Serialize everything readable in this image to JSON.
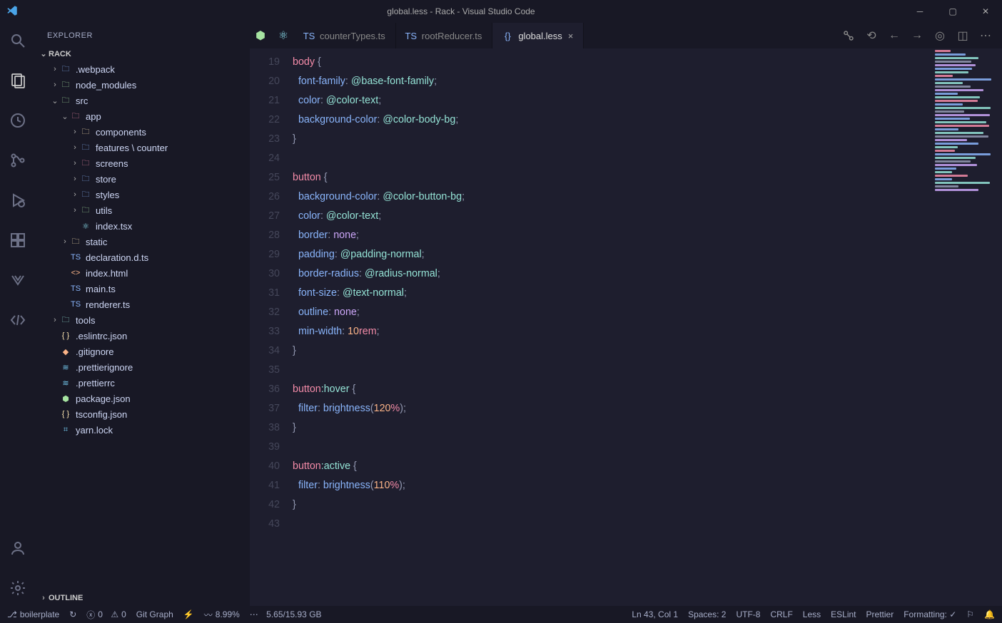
{
  "window": {
    "title": "global.less - Rack - Visual Studio Code"
  },
  "sidebar": {
    "title": "EXPLORER",
    "root": "RACK",
    "outline": "OUTLINE",
    "tree": [
      {
        "depth": 1,
        "chev": "›",
        "icon": "folder",
        "iconClass": "ic-folder",
        "label": ".webpack"
      },
      {
        "depth": 1,
        "chev": "›",
        "icon": "folder",
        "iconClass": "ic-folder-g",
        "label": "node_modules"
      },
      {
        "depth": 1,
        "chev": "⌄",
        "icon": "folder",
        "iconClass": "ic-folder-g",
        "label": "src"
      },
      {
        "depth": 2,
        "chev": "⌄",
        "icon": "folder",
        "iconClass": "ic-folder-r",
        "label": "app"
      },
      {
        "depth": 3,
        "chev": "›",
        "icon": "folder",
        "iconClass": "ic-folder-y",
        "label": "components"
      },
      {
        "depth": 3,
        "chev": "›",
        "icon": "folder",
        "iconClass": "ic-folder",
        "label": "features \\ counter"
      },
      {
        "depth": 3,
        "chev": "›",
        "icon": "folder",
        "iconClass": "ic-folder-r",
        "label": "screens"
      },
      {
        "depth": 3,
        "chev": "›",
        "icon": "folder",
        "iconClass": "ic-folder",
        "label": "store"
      },
      {
        "depth": 3,
        "chev": "›",
        "icon": "folder",
        "iconClass": "ic-folder",
        "label": "styles"
      },
      {
        "depth": 3,
        "chev": "›",
        "icon": "folder",
        "iconClass": "ic-folder-g",
        "label": "utils"
      },
      {
        "depth": 3,
        "chev": "",
        "icon": "react",
        "iconClass": "ic-react",
        "label": "index.tsx"
      },
      {
        "depth": 2,
        "chev": "›",
        "icon": "folder",
        "iconClass": "ic-folder-y",
        "label": "static"
      },
      {
        "depth": 2,
        "chev": "",
        "icon": "ts",
        "iconClass": "ic-ts",
        "label": "declaration.d.ts"
      },
      {
        "depth": 2,
        "chev": "",
        "icon": "html",
        "iconClass": "ic-html",
        "label": "index.html"
      },
      {
        "depth": 2,
        "chev": "",
        "icon": "ts",
        "iconClass": "ic-ts",
        "label": "main.ts"
      },
      {
        "depth": 2,
        "chev": "",
        "icon": "ts",
        "iconClass": "ic-ts",
        "label": "renderer.ts"
      },
      {
        "depth": 1,
        "chev": "›",
        "icon": "folder",
        "iconClass": "ic-folder-t",
        "label": "tools"
      },
      {
        "depth": 1,
        "chev": "",
        "icon": "json",
        "iconClass": "ic-json",
        "label": ".eslintrc.json"
      },
      {
        "depth": 1,
        "chev": "",
        "icon": "git",
        "iconClass": "ic-git",
        "label": ".gitignore"
      },
      {
        "depth": 1,
        "chev": "",
        "icon": "pr",
        "iconClass": "ic-pr",
        "label": ".prettierignore"
      },
      {
        "depth": 1,
        "chev": "",
        "icon": "pr",
        "iconClass": "ic-pr",
        "label": ".prettierrc"
      },
      {
        "depth": 1,
        "chev": "",
        "icon": "node",
        "iconClass": "ic-node",
        "label": "package.json"
      },
      {
        "depth": 1,
        "chev": "",
        "icon": "json",
        "iconClass": "ic-json",
        "label": "tsconfig.json"
      },
      {
        "depth": 1,
        "chev": "",
        "icon": "yarn",
        "iconClass": "ic-yarn",
        "label": "yarn.lock"
      }
    ]
  },
  "tabs": [
    {
      "icon": "ts",
      "iconClass": "ic-ts",
      "label": "counterTypes.ts",
      "active": false,
      "close": false
    },
    {
      "icon": "ts",
      "iconClass": "ic-ts",
      "label": "rootReducer.ts",
      "active": false,
      "close": false
    },
    {
      "icon": "less",
      "iconClass": "ic-less",
      "label": "global.less",
      "active": true,
      "close": true
    }
  ],
  "editor": {
    "startLine": 19,
    "lines": [
      [
        [
          "sel",
          "body"
        ],
        [
          "punc",
          " {"
        ]
      ],
      [
        [
          "",
          "  "
        ],
        [
          "prop",
          "font-family"
        ],
        [
          "punc",
          ": "
        ],
        [
          "var",
          "@base-font-family"
        ],
        [
          "punc",
          ";"
        ]
      ],
      [
        [
          "",
          "  "
        ],
        [
          "prop",
          "color"
        ],
        [
          "punc",
          ": "
        ],
        [
          "var",
          "@color-text"
        ],
        [
          "punc",
          ";"
        ]
      ],
      [
        [
          "",
          "  "
        ],
        [
          "prop",
          "background-color"
        ],
        [
          "punc",
          ": "
        ],
        [
          "var",
          "@color-body-bg"
        ],
        [
          "punc",
          ";"
        ]
      ],
      [
        [
          "punc",
          "}"
        ]
      ],
      [],
      [
        [
          "sel",
          "button"
        ],
        [
          "punc",
          " {"
        ]
      ],
      [
        [
          "",
          "  "
        ],
        [
          "prop",
          "background-color"
        ],
        [
          "punc",
          ": "
        ],
        [
          "var",
          "@color-button-bg"
        ],
        [
          "punc",
          ";"
        ]
      ],
      [
        [
          "",
          "  "
        ],
        [
          "prop",
          "color"
        ],
        [
          "punc",
          ": "
        ],
        [
          "var",
          "@color-text"
        ],
        [
          "punc",
          ";"
        ]
      ],
      [
        [
          "",
          "  "
        ],
        [
          "prop",
          "border"
        ],
        [
          "punc",
          ": "
        ],
        [
          "val",
          "none"
        ],
        [
          "punc",
          ";"
        ]
      ],
      [
        [
          "",
          "  "
        ],
        [
          "prop",
          "padding"
        ],
        [
          "punc",
          ": "
        ],
        [
          "var",
          "@padding-normal"
        ],
        [
          "punc",
          ";"
        ]
      ],
      [
        [
          "",
          "  "
        ],
        [
          "prop",
          "border-radius"
        ],
        [
          "punc",
          ": "
        ],
        [
          "var",
          "@radius-normal"
        ],
        [
          "punc",
          ";"
        ]
      ],
      [
        [
          "",
          "  "
        ],
        [
          "prop",
          "font-size"
        ],
        [
          "punc",
          ": "
        ],
        [
          "var",
          "@text-normal"
        ],
        [
          "punc",
          ";"
        ]
      ],
      [
        [
          "",
          "  "
        ],
        [
          "prop",
          "outline"
        ],
        [
          "punc",
          ": "
        ],
        [
          "val",
          "none"
        ],
        [
          "punc",
          ";"
        ]
      ],
      [
        [
          "",
          "  "
        ],
        [
          "prop",
          "min-width"
        ],
        [
          "punc",
          ": "
        ],
        [
          "num",
          "10"
        ],
        [
          "unit",
          "rem"
        ],
        [
          "punc",
          ";"
        ]
      ],
      [
        [
          "punc",
          "}"
        ]
      ],
      [],
      [
        [
          "sel",
          "button"
        ],
        [
          "pseudo",
          ":hover"
        ],
        [
          "punc",
          " {"
        ]
      ],
      [
        [
          "",
          "  "
        ],
        [
          "prop",
          "filter"
        ],
        [
          "punc",
          ": "
        ],
        [
          "func",
          "brightness"
        ],
        [
          "punc",
          "("
        ],
        [
          "num",
          "120"
        ],
        [
          "unit",
          "%"
        ],
        [
          "punc",
          ");"
        ]
      ],
      [
        [
          "punc",
          "}"
        ]
      ],
      [],
      [
        [
          "sel",
          "button"
        ],
        [
          "pseudo",
          ":active"
        ],
        [
          "punc",
          " {"
        ]
      ],
      [
        [
          "",
          "  "
        ],
        [
          "prop",
          "filter"
        ],
        [
          "punc",
          ": "
        ],
        [
          "func",
          "brightness"
        ],
        [
          "punc",
          "("
        ],
        [
          "num",
          "110"
        ],
        [
          "unit",
          "%"
        ],
        [
          "punc",
          ");"
        ]
      ],
      [
        [
          "punc",
          "}"
        ]
      ],
      []
    ]
  },
  "status": {
    "branch": "boilerplate",
    "sync": "↻",
    "errors": "0",
    "warnings": "0",
    "gitgraph": "Git Graph",
    "cpu": "8.99%",
    "mem": "5.65/15.93 GB",
    "cursor": "Ln 43, Col 1",
    "spaces": "Spaces: 2",
    "encoding": "UTF-8",
    "eol": "CRLF",
    "lang": "Less",
    "eslint": "ESLint",
    "prettier": "Prettier",
    "formatting": "Formatting: ✓"
  }
}
